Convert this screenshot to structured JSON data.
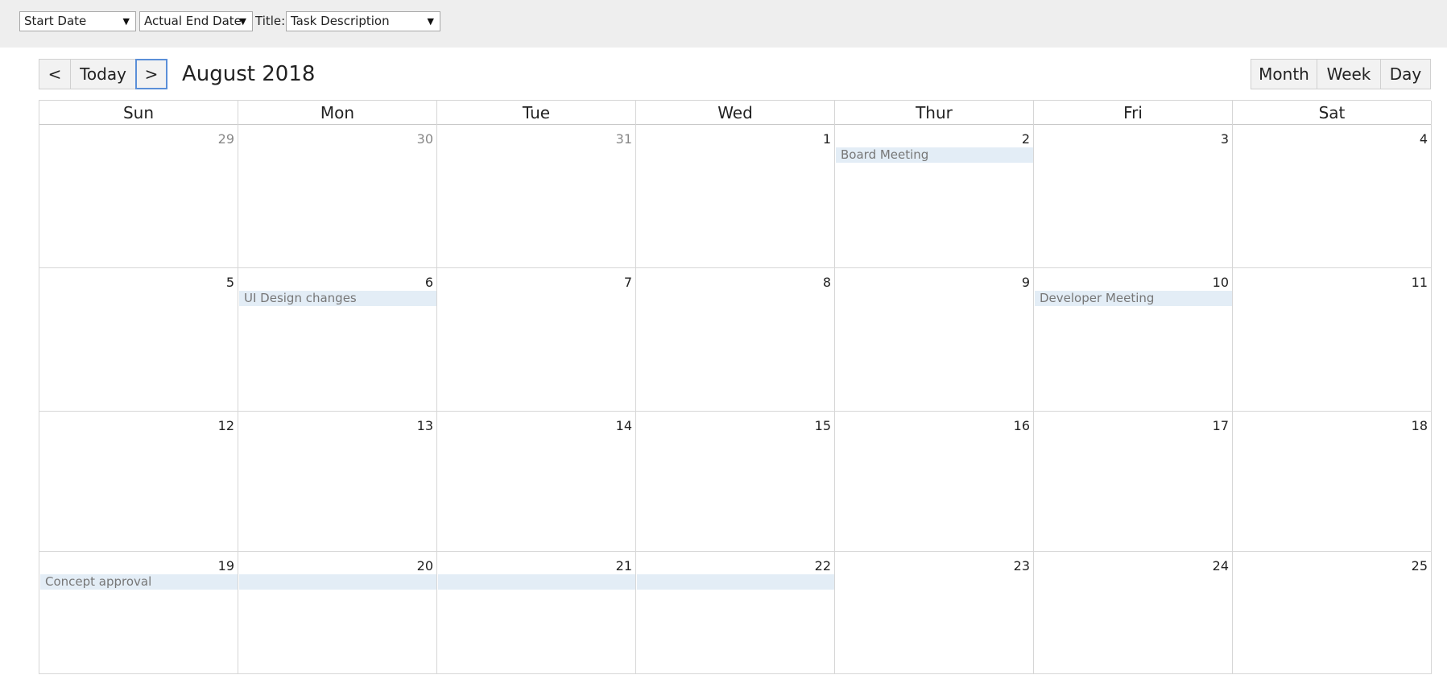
{
  "filters": {
    "start_field": "Start Date",
    "end_field": "Actual End Date",
    "title_label": "Title:",
    "title_field": "Task Description",
    "caret": "▼"
  },
  "nav": {
    "prev_label": "<",
    "today_label": "Today",
    "next_label": ">",
    "current_period": "August 2018"
  },
  "views": {
    "month_label": "Month",
    "week_label": "Week",
    "day_label": "Day"
  },
  "weekdays": [
    "Sun",
    "Mon",
    "Tue",
    "Wed",
    "Thur",
    "Fri",
    "Sat"
  ],
  "weeks": [
    [
      {
        "num": "29",
        "other": true
      },
      {
        "num": "30",
        "other": true
      },
      {
        "num": "31",
        "other": true
      },
      {
        "num": "1"
      },
      {
        "num": "2",
        "event": "Board Meeting"
      },
      {
        "num": "3"
      },
      {
        "num": "4"
      }
    ],
    [
      {
        "num": "5"
      },
      {
        "num": "6",
        "event": "UI Design changes"
      },
      {
        "num": "7"
      },
      {
        "num": "8"
      },
      {
        "num": "9"
      },
      {
        "num": "10",
        "event": "Developer Meeting"
      },
      {
        "num": "11"
      }
    ],
    [
      {
        "num": "12"
      },
      {
        "num": "13"
      },
      {
        "num": "14"
      },
      {
        "num": "15"
      },
      {
        "num": "16"
      },
      {
        "num": "17"
      },
      {
        "num": "18"
      }
    ],
    [
      {
        "num": "19",
        "event": "Concept approval"
      },
      {
        "num": "20",
        "event": ""
      },
      {
        "num": "21",
        "event": ""
      },
      {
        "num": "22",
        "event": ""
      },
      {
        "num": "23"
      },
      {
        "num": "24"
      },
      {
        "num": "25"
      }
    ]
  ],
  "colors": {
    "event_bg": "#e3edf6",
    "toolbar_bg": "#eeeeee",
    "active_border": "#5b8fd8"
  }
}
